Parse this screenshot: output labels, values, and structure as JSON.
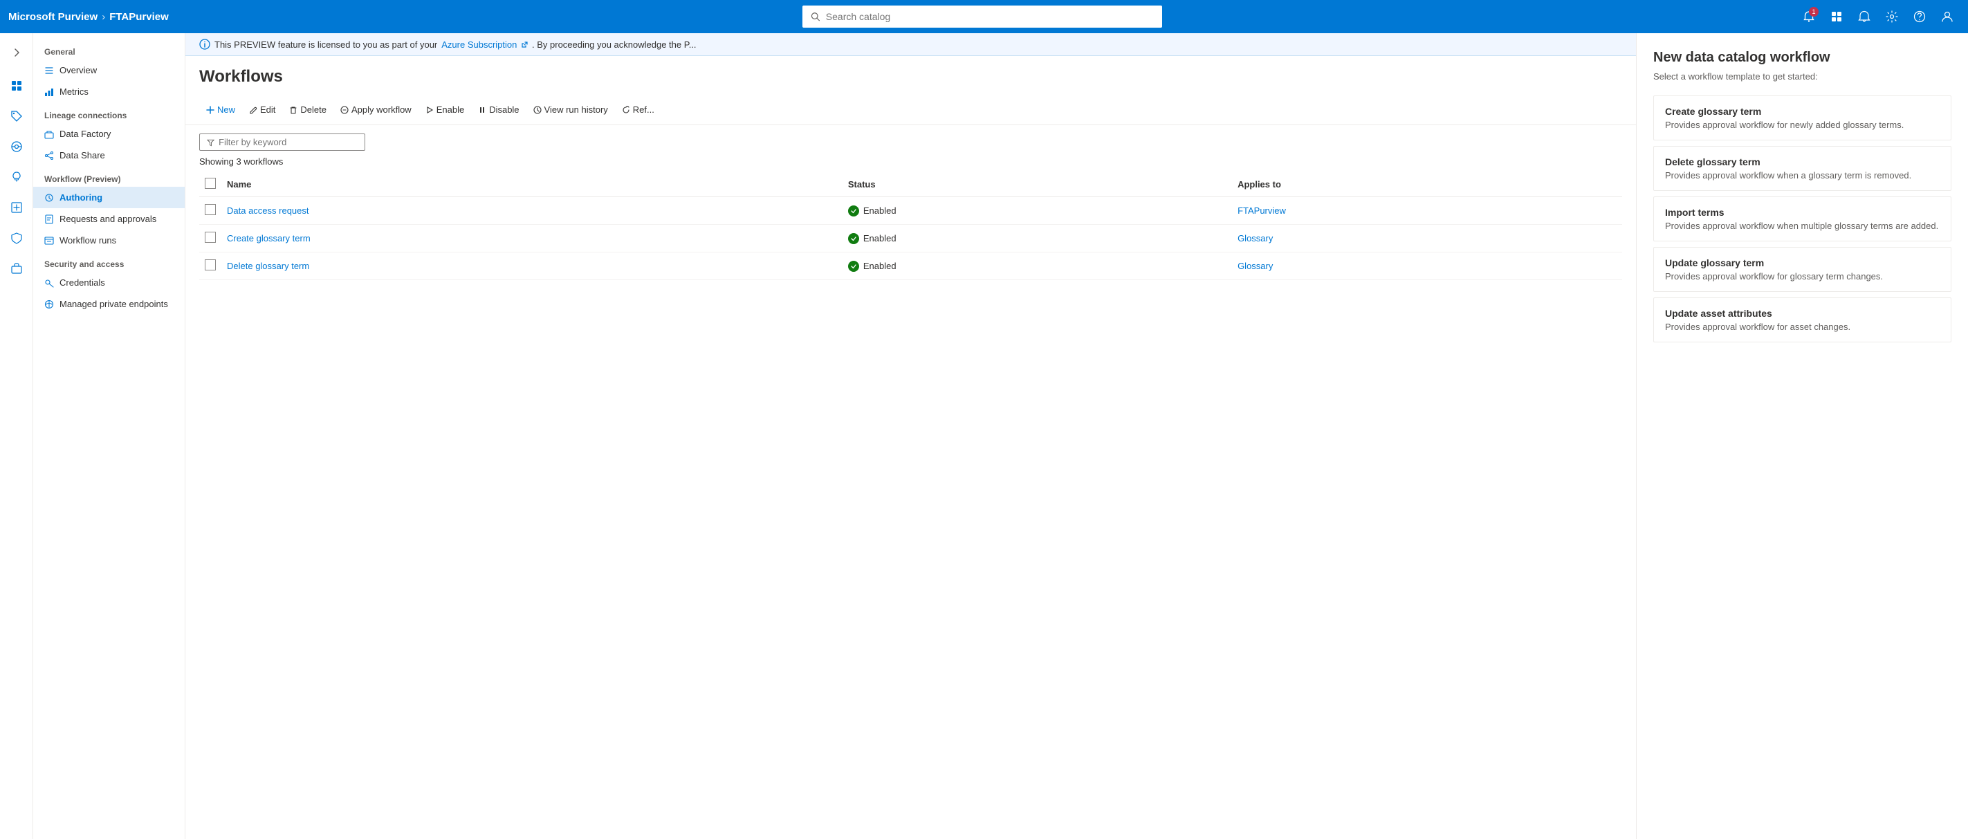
{
  "topNav": {
    "brand": "Microsoft Purview",
    "separator": "›",
    "tenant": "FTAPurview",
    "searchPlaceholder": "Search catalog",
    "notificationBadge": "1"
  },
  "iconBar": {
    "collapseLabel": "«",
    "expandLabel": "»"
  },
  "sidebar": {
    "sections": [
      {
        "label": "General",
        "items": [
          {
            "id": "overview",
            "label": "Overview",
            "icon": "list-icon"
          },
          {
            "id": "metrics",
            "label": "Metrics",
            "icon": "chart-icon"
          }
        ]
      },
      {
        "label": "Lineage connections",
        "items": [
          {
            "id": "data-factory",
            "label": "Data Factory",
            "icon": "factory-icon"
          },
          {
            "id": "data-share",
            "label": "Data Share",
            "icon": "share-icon"
          }
        ]
      },
      {
        "label": "Workflow (Preview)",
        "items": [
          {
            "id": "authoring",
            "label": "Authoring",
            "icon": "authoring-icon",
            "active": true
          },
          {
            "id": "requests",
            "label": "Requests and approvals",
            "icon": "requests-icon"
          },
          {
            "id": "workflow-runs",
            "label": "Workflow runs",
            "icon": "runs-icon"
          }
        ]
      },
      {
        "label": "Security and access",
        "items": [
          {
            "id": "credentials",
            "label": "Credentials",
            "icon": "credentials-icon"
          },
          {
            "id": "managed-endpoints",
            "label": "Managed private endpoints",
            "icon": "endpoints-icon"
          }
        ]
      }
    ]
  },
  "previewBanner": {
    "text": "This PREVIEW feature is licensed to you as part of your",
    "linkText": "Azure Subscription",
    "suffix": ". By proceeding you acknowledge the P..."
  },
  "pageTitle": "Workflows",
  "toolbar": {
    "newLabel": "New",
    "editLabel": "Edit",
    "deleteLabel": "Delete",
    "applyWorkflowLabel": "Apply workflow",
    "enableLabel": "Enable",
    "disableLabel": "Disable",
    "viewRunHistoryLabel": "View run history",
    "refreshLabel": "Ref..."
  },
  "filter": {
    "placeholder": "Filter by keyword"
  },
  "showingCount": "Showing 3 workflows",
  "tableColumns": [
    "Name",
    "Status",
    "Applies to"
  ],
  "tableRows": [
    {
      "name": "Data access request",
      "status": "Enabled",
      "appliesTo": "FTAPurview"
    },
    {
      "name": "Create glossary term",
      "status": "Enabled",
      "appliesTo": "Glossary"
    },
    {
      "name": "Delete glossary term",
      "status": "Enabled",
      "appliesTo": "Glossary"
    }
  ],
  "rightPanel": {
    "title": "New data catalog workflow",
    "subtitle": "Select a workflow template to get started:",
    "templates": [
      {
        "id": "create-glossary-term",
        "title": "Create glossary term",
        "description": "Provides approval workflow for newly added glossary terms."
      },
      {
        "id": "delete-glossary-term",
        "title": "Delete glossary term",
        "description": "Provides approval workflow when a glossary term is removed."
      },
      {
        "id": "import-terms",
        "title": "Import terms",
        "description": "Provides approval workflow when multiple glossary terms are added."
      },
      {
        "id": "update-glossary-term",
        "title": "Update glossary term",
        "description": "Provides approval workflow for glossary term changes."
      },
      {
        "id": "update-asset-attributes",
        "title": "Update asset attributes",
        "description": "Provides approval workflow for asset changes."
      }
    ]
  },
  "colors": {
    "primary": "#0078d4",
    "success": "#107c10",
    "background": "#f3f2f1",
    "border": "#edebe9",
    "textPrimary": "#323130",
    "textSecondary": "#605e5c"
  }
}
